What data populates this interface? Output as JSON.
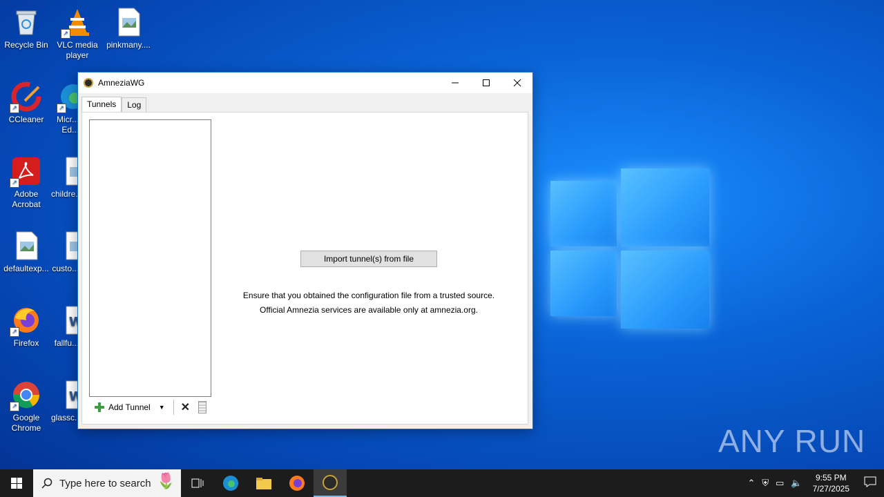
{
  "desktop": {
    "icons": [
      {
        "label": "Recycle Bin",
        "icon": "recycle-bin-icon"
      },
      {
        "label": "VLC media player",
        "icon": "vlc-icon"
      },
      {
        "label": "pinkmany....",
        "icon": "image-file-icon"
      },
      {
        "label": "CCleaner",
        "icon": "ccleaner-icon"
      },
      {
        "label": "Micr... Ed...",
        "icon": "edge-icon"
      },
      {
        "label": "Adobe Acrobat",
        "icon": "acrobat-icon"
      },
      {
        "label": "childre...",
        "icon": "image-file-icon"
      },
      {
        "label": "defaultexp...",
        "icon": "image-file-icon"
      },
      {
        "label": "custo...",
        "icon": "image-file-icon"
      },
      {
        "label": "Firefox",
        "icon": "firefox-icon"
      },
      {
        "label": "fallfu...",
        "icon": "word-icon"
      },
      {
        "label": "Google Chrome",
        "icon": "chrome-icon"
      },
      {
        "label": "glassc...",
        "icon": "word-icon"
      }
    ]
  },
  "window": {
    "title": "AmneziaWG",
    "tabs": [
      {
        "label": "Tunnels"
      },
      {
        "label": "Log"
      }
    ],
    "toolbar": {
      "add_tunnel": "Add Tunnel"
    },
    "import_button": "Import tunnel(s) from file",
    "notice_line1": "Ensure that you obtained the configuration file from a trusted source.",
    "notice_line2": "Official Amnezia services are available only at amnezia.org."
  },
  "watermark": "ANY RUN",
  "taskbar": {
    "search_placeholder": "Type here to search",
    "time": "9:55 PM",
    "date": "7/27/2025"
  },
  "colors": {
    "accent": "#1f70c9",
    "desktop_bg": "#0a63d6",
    "taskbar": "#1c1c1c"
  }
}
